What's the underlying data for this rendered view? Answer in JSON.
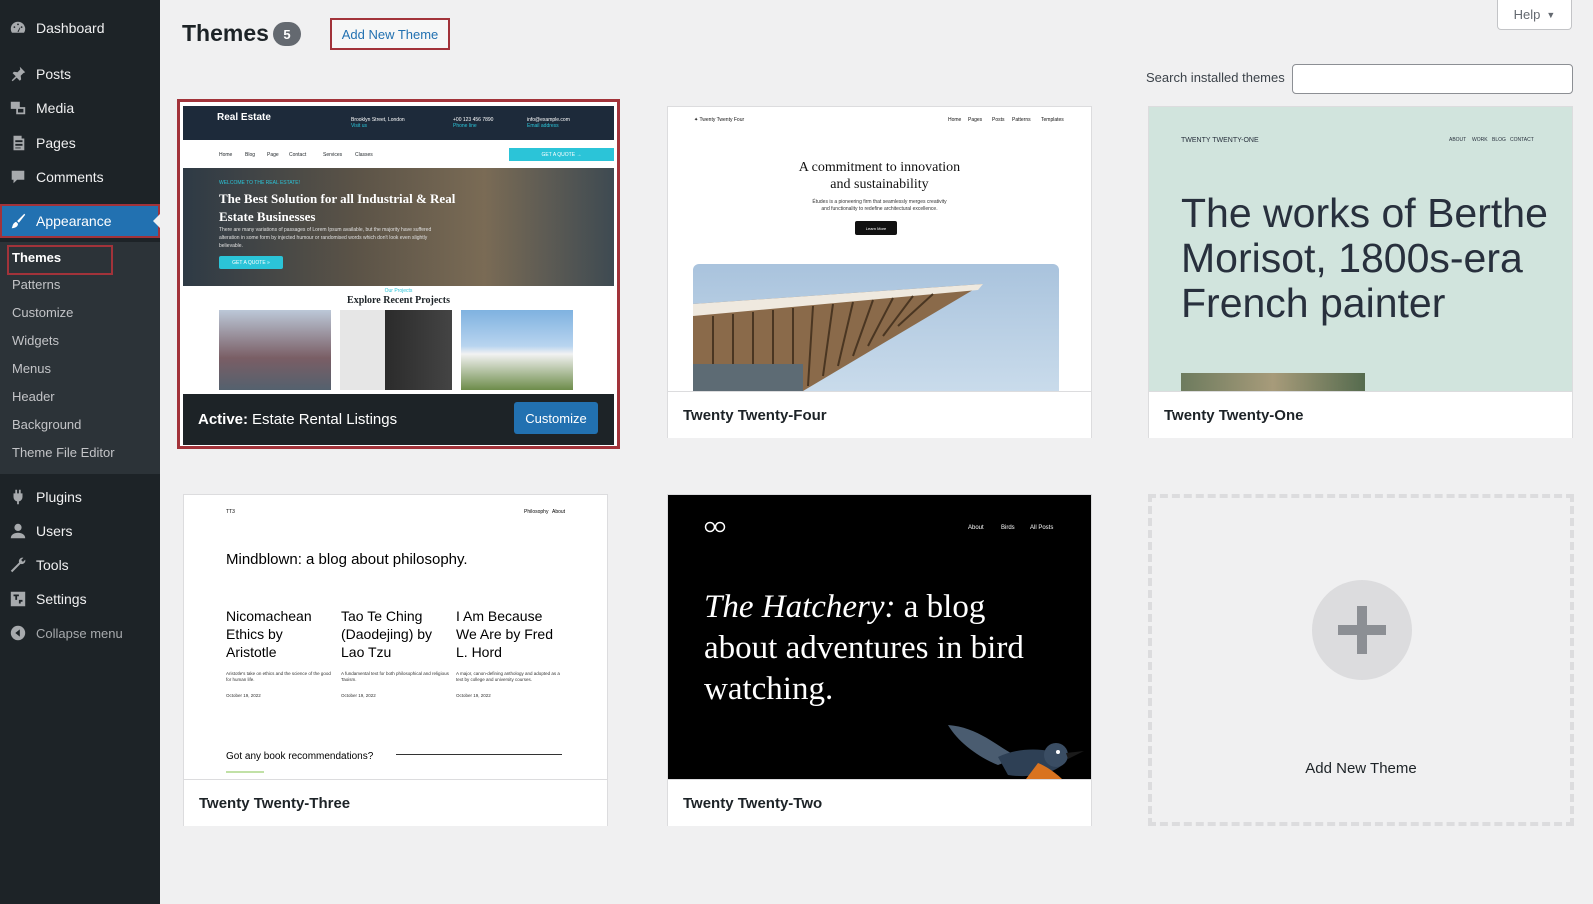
{
  "sidebar": {
    "items": [
      {
        "label": "Dashboard",
        "icon": "dashboard-icon"
      },
      {
        "label": "Posts",
        "icon": "pin-icon"
      },
      {
        "label": "Media",
        "icon": "media-icon"
      },
      {
        "label": "Pages",
        "icon": "pages-icon"
      },
      {
        "label": "Comments",
        "icon": "comment-icon"
      },
      {
        "label": "Appearance",
        "icon": "brush-icon"
      },
      {
        "label": "Plugins",
        "icon": "plugin-icon"
      },
      {
        "label": "Users",
        "icon": "user-icon"
      },
      {
        "label": "Tools",
        "icon": "wrench-icon"
      },
      {
        "label": "Settings",
        "icon": "settings-icon"
      }
    ],
    "submenu": [
      "Themes",
      "Patterns",
      "Customize",
      "Widgets",
      "Menus",
      "Header",
      "Background",
      "Theme File Editor"
    ],
    "collapse_label": "Collapse menu"
  },
  "header": {
    "title": "Themes",
    "count": "5",
    "add_new_label": "Add New Theme",
    "help_label": "Help",
    "search_label": "Search installed themes",
    "search_value": ""
  },
  "themes": {
    "active": {
      "active_prefix": "Active:",
      "name": "Estate Rental Listings",
      "customize_label": "Customize",
      "preview": {
        "logo": "Real Estate",
        "info1": "Brooklyn Street, London",
        "info1_sub": "Visit us",
        "info2": "+00 123 456 7890",
        "info2_sub": "Phone line",
        "info3": "info@example.com",
        "info3_sub": "Email address",
        "nav": [
          "Home",
          "Blog",
          "Page",
          "Contact",
          "Services",
          "Classes"
        ],
        "quote_btn": "GET A QUOTE →",
        "welcome": "WELCOME TO THE REAL ESTATE!",
        "hero_title": "The Best Solution for all Industrial & Real Estate Businesses",
        "hero_text": "There are many variations of passages of Lorem Ipsum available, but the majority have suffered alteration in some form by injected humour or randomised words which don't look even slightly believable.",
        "hero_btn": "GET A QUOTE »",
        "projects_sub": "Our Projects",
        "projects_title": "Explore Recent Projects"
      }
    },
    "tt4": {
      "name": "Twenty Twenty-Four",
      "preview": {
        "brand": "Twenty Twenty Four",
        "nav": [
          "Home",
          "Pages",
          "Posts",
          "Patterns",
          "Templates"
        ],
        "headline_1": "A commitment to innovation",
        "headline_2": "and sustainability",
        "para_1": "Études is a pioneering firm that seamlessly merges creativity",
        "para_2": "and functionality to redefine architectural excellence.",
        "btn": "Learn More"
      }
    },
    "tt1": {
      "name": "Twenty Twenty-One",
      "preview": {
        "brand": "TWENTY TWENTY-ONE",
        "nav": [
          "ABOUT",
          "WORK",
          "BLOG",
          "CONTACT"
        ],
        "headline": "The works of Berthe Morisot, 1800s-era French painter"
      }
    },
    "tt3": {
      "name": "Twenty Twenty-Three",
      "preview": {
        "brand": "TT3",
        "nav": [
          "Philosophy",
          "About"
        ],
        "headline": "Mindblown: a blog about philosophy.",
        "posts": [
          {
            "title": "Nicomachean Ethics by Aristotle",
            "desc": "Aristotle's take on ethics and the science of the good for human life.",
            "date": "October 19, 2022"
          },
          {
            "title": "Tao Te Ching (Daodejing) by Lao Tzu",
            "desc": "A fundamental text for both philosophical and religious Taoism.",
            "date": "October 19, 2022"
          },
          {
            "title": "I Am Because We Are by Fred L. Hord",
            "desc": "A major, canon-defining anthology and adopted as a text by college and university courses.",
            "date": "October 19, 2022"
          }
        ],
        "question": "Got any book recommendations?"
      }
    },
    "tt2": {
      "name": "Twenty Twenty-Two",
      "preview": {
        "nav": [
          "About",
          "Birds",
          "All Posts"
        ],
        "headline_italic": "The Hatchery:",
        "headline_rest": " a blog about adventures in bird watching."
      }
    },
    "add_new_label": "Add New Theme"
  },
  "colors": {
    "accent": "#2271b1",
    "sidebar_bg": "#1d2327",
    "highlight_border": "#a2333a"
  }
}
